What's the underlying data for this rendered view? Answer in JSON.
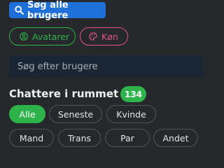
{
  "toolbar": {
    "search_all_label": "Søg alle brugere",
    "avatars_label": "Avatarer",
    "gender_label": "Køn"
  },
  "search": {
    "placeholder": "Søg efter brugere"
  },
  "room": {
    "title": "Chattere i rummet",
    "count": "134"
  },
  "filters": [
    {
      "label": "Alle",
      "active": true
    },
    {
      "label": "Seneste",
      "active": false
    },
    {
      "label": "Kvinde",
      "active": false
    },
    {
      "label": "Mand",
      "active": false
    },
    {
      "label": "Trans",
      "active": false
    },
    {
      "label": "Par",
      "active": false
    },
    {
      "label": "Andet",
      "active": false
    }
  ],
  "colors": {
    "background": "#26282c",
    "primary_blue": "#1f6fd9",
    "accent_green": "#2eb34a",
    "accent_pink": "#e0558d",
    "input_background": "#1b2634"
  },
  "icons": {
    "search_all": "search-icon",
    "avatars": "user-circle-icon",
    "gender": "palette-icon"
  }
}
